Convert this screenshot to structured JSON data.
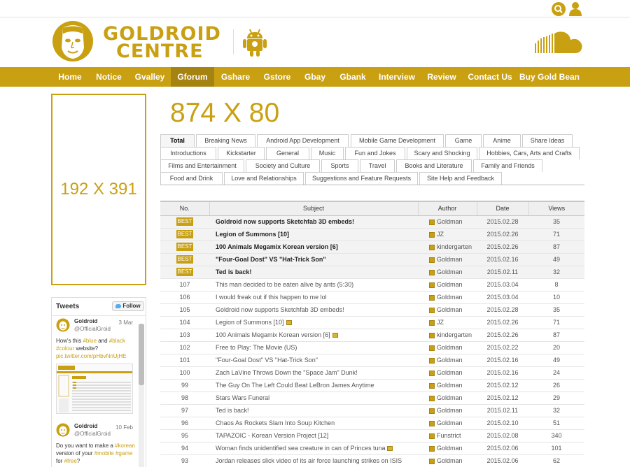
{
  "header": {
    "logo_line1": "GOLDROID",
    "logo_line2": "CENTRE",
    "icons": [
      "search-icon",
      "user-icon",
      "goldroid-face-logo",
      "android-icon",
      "soundcloud-icon"
    ]
  },
  "nav": [
    {
      "label": "Home"
    },
    {
      "label": "Notice"
    },
    {
      "label": "Gvalley"
    },
    {
      "label": "Gforum"
    },
    {
      "label": "Gshare"
    },
    {
      "label": "Gstore"
    },
    {
      "label": "Gbay"
    },
    {
      "label": "Gbank"
    },
    {
      "label": "Interview"
    },
    {
      "label": "Review"
    },
    {
      "label": "Contact Us"
    },
    {
      "label": "Buy Gold Bean"
    }
  ],
  "ads": {
    "left": "192 X 391",
    "banner": "874 X 80"
  },
  "twitter": {
    "title": "Tweets",
    "follow": "Follow",
    "tweets": [
      {
        "name": "Goldroid",
        "handle": "@OfficialGroid",
        "date": "3 Mar",
        "t1": "How's this ",
        "tag1": "#blue",
        "t2": " and ",
        "tag2": "#black",
        "tag3": "#colour",
        "t3": " website?",
        "link": "pic.twitter.com/pHbvNnUjHE"
      },
      {
        "name": "Goldroid",
        "handle": "@OfficialGroid",
        "date": "10 Feb",
        "t1": "Do you want to make a ",
        "tag1": "#korean",
        "t2": " version of your ",
        "tag2": "#mobile",
        "tag3": "#game",
        "t3": " for ",
        "tag4": "#free",
        "t4": "?"
      }
    ]
  },
  "tabs": [
    [
      "Total",
      "Breaking News",
      "Android App Development",
      "Mobile Game Development",
      "Game",
      "Anime",
      "Share Ideas"
    ],
    [
      "Introductions",
      "Kickstarter",
      "General",
      "Music",
      "Fun and Jokes",
      "Scary and Shocking",
      "Hobbies, Cars, Arts and Crafts"
    ],
    [
      "Films and Entertainment",
      "Society and Culture",
      "Sports",
      "Travel",
      "Books and Literature",
      "Family and Friends"
    ],
    [
      "Food and Drink",
      "Love and Relationships",
      "Suggestions and Feature Requests",
      "Site Help and Feedback"
    ]
  ],
  "table": {
    "headers": [
      "No.",
      "Subject",
      "Author",
      "Date",
      "Views"
    ],
    "rows": [
      {
        "no": "BEST",
        "best": true,
        "subject": "Goldroid now supports Sketchfab 3D embeds!",
        "author": "Goldman",
        "date": "2015.02.28",
        "views": "35"
      },
      {
        "no": "BEST",
        "best": true,
        "subject": "Legion of Summons [10]",
        "author": "JZ",
        "date": "2015.02.26",
        "views": "71"
      },
      {
        "no": "BEST",
        "best": true,
        "subject": "100 Animals Megamix Korean version [6]",
        "author": "kindergarten",
        "date": "2015.02.26",
        "views": "87"
      },
      {
        "no": "BEST",
        "best": true,
        "subject": "\"Four-Goal Dost\" VS \"Hat-Trick Son\"",
        "author": "Goldman",
        "date": "2015.02.16",
        "views": "49"
      },
      {
        "no": "BEST",
        "best": true,
        "subject": "Ted is back!",
        "author": "Goldman",
        "date": "2015.02.11",
        "views": "32"
      },
      {
        "no": "107",
        "subject": "This man decided to be eaten alive by ants (5:30)",
        "author": "Goldman",
        "date": "2015.03.04",
        "views": "8"
      },
      {
        "no": "106",
        "subject": "I would freak out if this happen to me lol",
        "author": "Goldman",
        "date": "2015.03.04",
        "views": "10"
      },
      {
        "no": "105",
        "subject": "Goldroid now supports Sketchfab 3D embeds!",
        "author": "Goldman",
        "date": "2015.02.28",
        "views": "35"
      },
      {
        "no": "104",
        "subject": "Legion of Summons [10]",
        "img": true,
        "author": "JZ",
        "date": "2015.02.26",
        "views": "71"
      },
      {
        "no": "103",
        "subject": "100 Animals Megamix Korean version [6]",
        "img": true,
        "author": "kindergarten",
        "date": "2015.02.26",
        "views": "87"
      },
      {
        "no": "102",
        "subject": "Free to Play: The Movie (US)",
        "author": "Goldman",
        "date": "2015.02.22",
        "views": "20"
      },
      {
        "no": "101",
        "subject": "\"Four-Goal Dost\" VS \"Hat-Trick Son\"",
        "author": "Goldman",
        "date": "2015.02.16",
        "views": "49"
      },
      {
        "no": "100",
        "subject": "Zach LaVine Throws Down the \"Space Jam\" Dunk!",
        "author": "Goldman",
        "date": "2015.02.16",
        "views": "24"
      },
      {
        "no": "99",
        "subject": "The Guy On The Left Could Beat LeBron James Anytime",
        "author": "Goldman",
        "date": "2015.02.12",
        "views": "26"
      },
      {
        "no": "98",
        "subject": "Stars Wars Funeral",
        "author": "Goldman",
        "date": "2015.02.12",
        "views": "29"
      },
      {
        "no": "97",
        "subject": "Ted is back!",
        "author": "Goldman",
        "date": "2015.02.11",
        "views": "32"
      },
      {
        "no": "96",
        "subject": "Chaos As Rockets Slam Into Soup Kitchen",
        "author": "Goldman",
        "date": "2015.02.10",
        "views": "51"
      },
      {
        "no": "95",
        "subject": "TAPAZOIC - Korean Version Project [12]",
        "author": "Funstrict",
        "date": "2015.02.08",
        "views": "340"
      },
      {
        "no": "94",
        "subject": "Woman finds unidentified sea creature in can of Princes tuna",
        "img": true,
        "author": "Goldman",
        "date": "2015.02.06",
        "views": "101"
      },
      {
        "no": "93",
        "subject": "Jordan releases slick video of its air force launching strikes on ISIS",
        "author": "Goldman",
        "date": "2015.02.06",
        "views": "62"
      }
    ]
  },
  "colors": {
    "accent": "#c9a012",
    "accent_dark": "#a58311"
  }
}
